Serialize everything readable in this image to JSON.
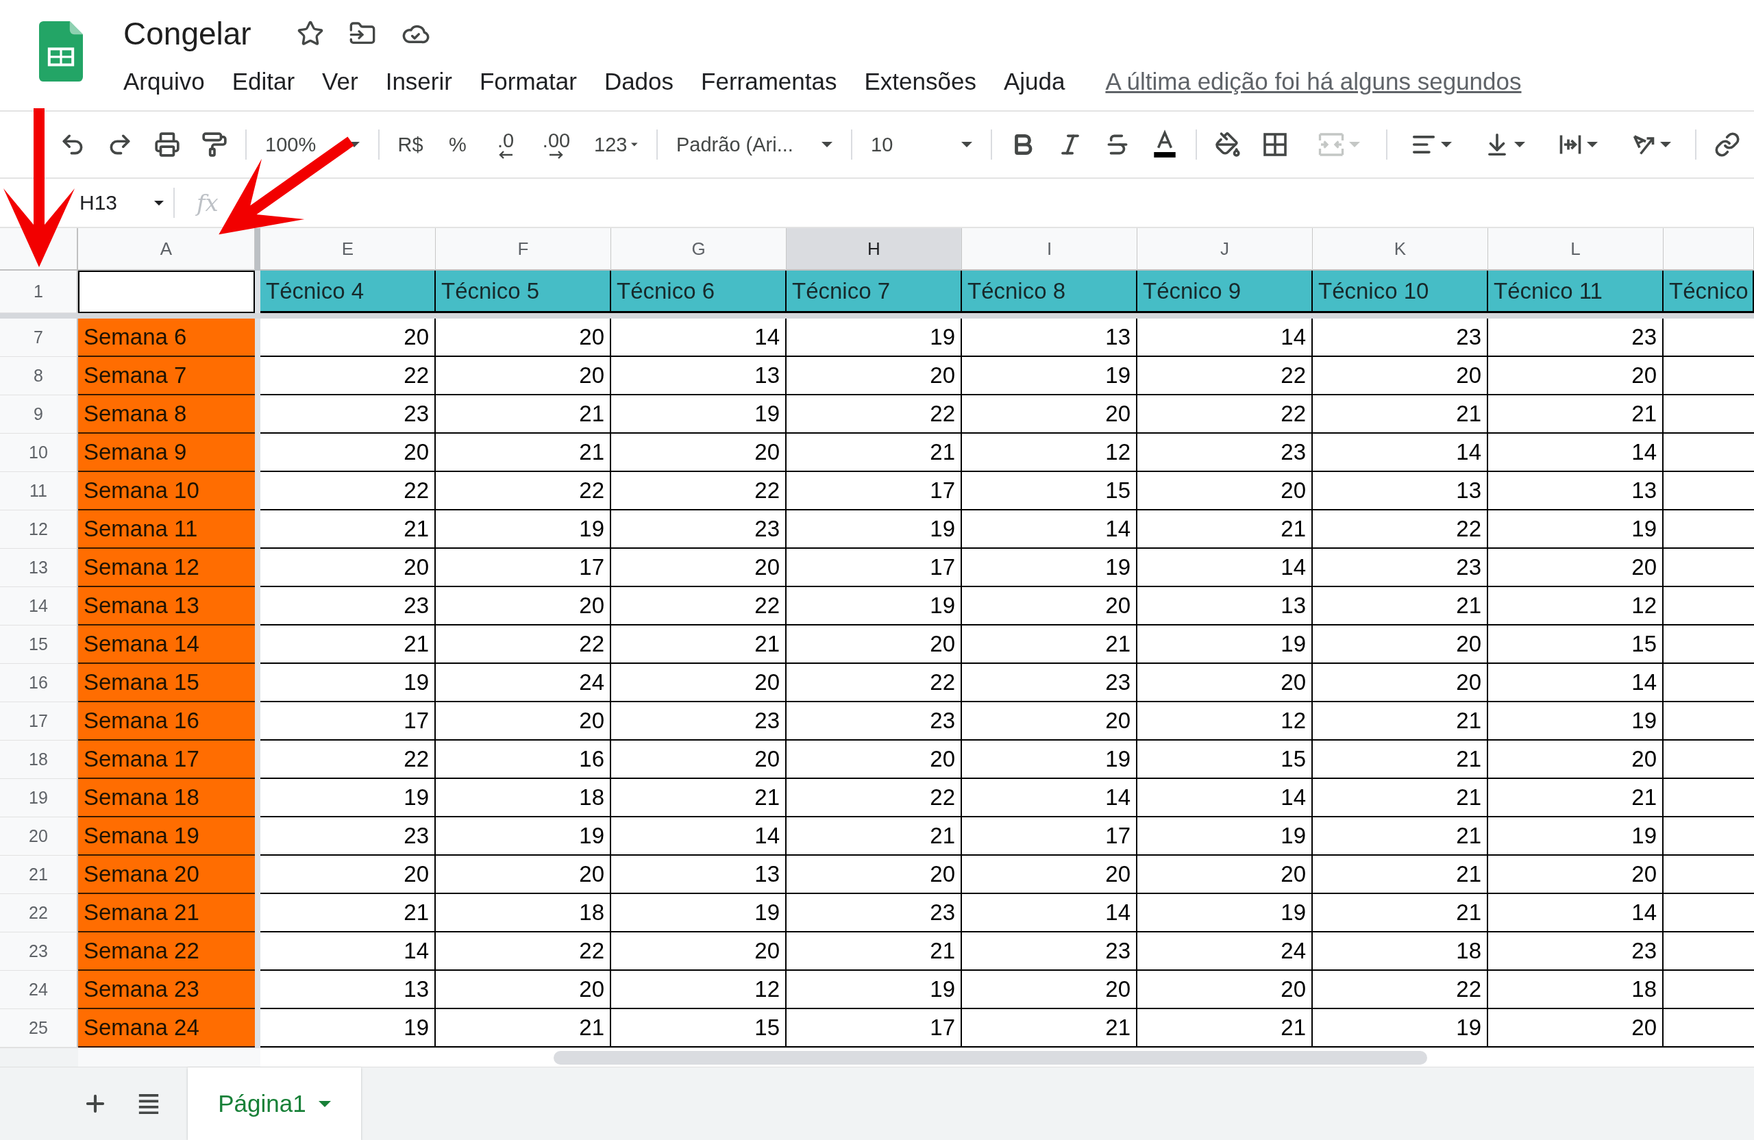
{
  "document": {
    "title": "Congelar",
    "menu": [
      "Arquivo",
      "Editar",
      "Ver",
      "Inserir",
      "Formatar",
      "Dados",
      "Ferramentas",
      "Extensões",
      "Ajuda"
    ],
    "last_edit": "A última edição foi há alguns segundos"
  },
  "toolbar": {
    "zoom": "100%",
    "currency": "R$",
    "percent": "%",
    "decrease_decimal": ".0",
    "increase_decimal": ".00",
    "number_format": "123",
    "font": "Padrão (Ari...",
    "font_size": "10",
    "merge": {
      "disabled": true
    }
  },
  "formula_bar": {
    "name_box": "H13",
    "function_label": "fx"
  },
  "sheet": {
    "columns": [
      {
        "label": "A",
        "selected": false
      },
      {
        "label": "E",
        "selected": false
      },
      {
        "label": "F",
        "selected": false
      },
      {
        "label": "G",
        "selected": false
      },
      {
        "label": "H",
        "selected": true
      },
      {
        "label": "I",
        "selected": false
      },
      {
        "label": "J",
        "selected": false
      },
      {
        "label": "K",
        "selected": false
      },
      {
        "label": "L",
        "selected": false
      },
      {
        "selected": false
      }
    ],
    "header_row": {
      "number": "1",
      "titles": [
        "Técnico 4",
        "Técnico 5",
        "Técnico 6",
        "Técnico 7",
        "Técnico 8",
        "Técnico 9",
        "Técnico 10",
        "Técnico 11",
        "Técnico"
      ]
    },
    "rows": [
      {
        "number": "7",
        "label": "Semana 6",
        "values": [
          "20",
          "20",
          "14",
          "19",
          "13",
          "14",
          "23",
          "23"
        ]
      },
      {
        "number": "8",
        "label": "Semana 7",
        "values": [
          "22",
          "20",
          "13",
          "20",
          "19",
          "22",
          "20",
          "20"
        ]
      },
      {
        "number": "9",
        "label": "Semana 8",
        "values": [
          "23",
          "21",
          "19",
          "22",
          "20",
          "22",
          "21",
          "21"
        ]
      },
      {
        "number": "10",
        "label": "Semana 9",
        "values": [
          "20",
          "21",
          "20",
          "21",
          "12",
          "23",
          "14",
          "14"
        ]
      },
      {
        "number": "11",
        "label": "Semana 10",
        "values": [
          "22",
          "22",
          "22",
          "17",
          "15",
          "20",
          "13",
          "13"
        ]
      },
      {
        "number": "12",
        "label": "Semana 11",
        "values": [
          "21",
          "19",
          "23",
          "19",
          "14",
          "21",
          "22",
          "19"
        ]
      },
      {
        "number": "13",
        "label": "Semana 12",
        "values": [
          "20",
          "17",
          "20",
          "17",
          "19",
          "14",
          "23",
          "20"
        ]
      },
      {
        "number": "14",
        "label": "Semana 13",
        "values": [
          "23",
          "20",
          "22",
          "19",
          "20",
          "13",
          "21",
          "12"
        ]
      },
      {
        "number": "15",
        "label": "Semana 14",
        "values": [
          "21",
          "22",
          "21",
          "20",
          "21",
          "19",
          "20",
          "15"
        ]
      },
      {
        "number": "16",
        "label": "Semana 15",
        "values": [
          "19",
          "24",
          "20",
          "22",
          "23",
          "20",
          "20",
          "14"
        ]
      },
      {
        "number": "17",
        "label": "Semana 16",
        "values": [
          "17",
          "20",
          "23",
          "23",
          "20",
          "12",
          "21",
          "19"
        ]
      },
      {
        "number": "18",
        "label": "Semana 17",
        "values": [
          "22",
          "16",
          "20",
          "20",
          "19",
          "15",
          "21",
          "20"
        ]
      },
      {
        "number": "19",
        "label": "Semana 18",
        "values": [
          "19",
          "18",
          "21",
          "22",
          "14",
          "14",
          "21",
          "21"
        ]
      },
      {
        "number": "20",
        "label": "Semana 19",
        "values": [
          "23",
          "19",
          "14",
          "21",
          "17",
          "19",
          "21",
          "19"
        ]
      },
      {
        "number": "21",
        "label": "Semana 20",
        "values": [
          "20",
          "20",
          "13",
          "20",
          "20",
          "20",
          "21",
          "20"
        ]
      },
      {
        "number": "22",
        "label": "Semana 21",
        "values": [
          "21",
          "18",
          "19",
          "23",
          "14",
          "19",
          "21",
          "14"
        ]
      },
      {
        "number": "23",
        "label": "Semana 22",
        "values": [
          "14",
          "22",
          "20",
          "21",
          "23",
          "24",
          "18",
          "23"
        ]
      },
      {
        "number": "24",
        "label": "Semana 23",
        "values": [
          "13",
          "20",
          "12",
          "19",
          "20",
          "20",
          "22",
          "18"
        ]
      },
      {
        "number": "25",
        "label": "Semana 24",
        "values": [
          "19",
          "21",
          "15",
          "17",
          "21",
          "21",
          "19",
          "20"
        ]
      }
    ]
  },
  "sheet_tabs": [
    {
      "label": "Página1",
      "selected": true
    }
  ]
}
